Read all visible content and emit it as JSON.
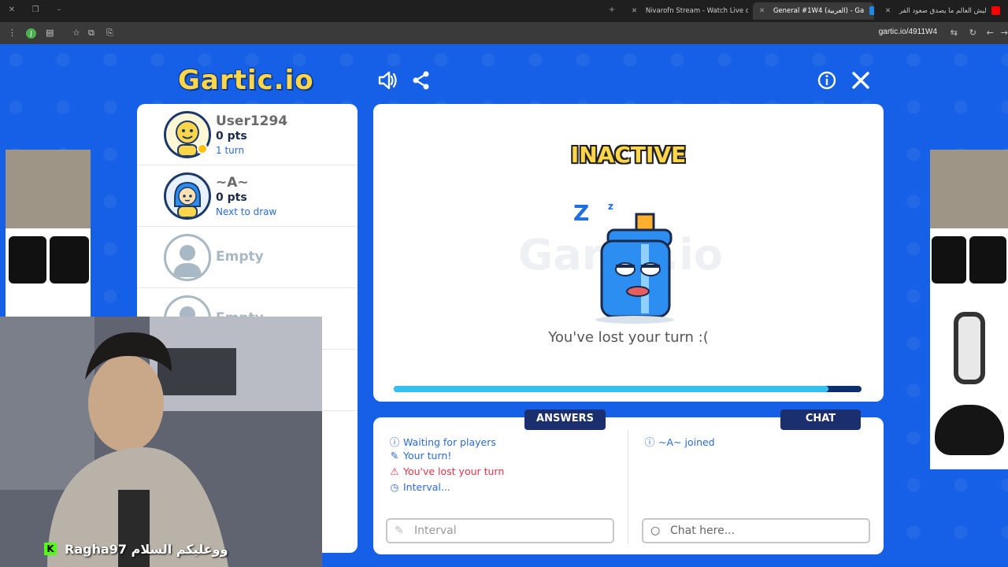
{
  "browser": {
    "tabs": [
      {
        "title": "ليش العالم ما يصدق صعود الفر",
        "active": false
      },
      {
        "title": "General #1W4 (العربية) - Ga",
        "active": true
      },
      {
        "title": "Nivarofn Stream - Watch Live o",
        "active": false
      }
    ],
    "url": "gartic.io/4911W4",
    "profile_initial": "J"
  },
  "game": {
    "logo": "Gartic.io",
    "players": [
      {
        "name": "User1294",
        "pts": "0 pts",
        "sub": "1 turn"
      },
      {
        "name": "~A~",
        "pts": "0 pts",
        "sub": "Next to draw"
      },
      {
        "name": "Empty"
      },
      {
        "name": "Empty"
      }
    ],
    "status_title": "INACTIVE",
    "watermark": "Gartic.io",
    "status_message": "You've lost your turn :(",
    "progress": 0.93,
    "answers_tab": "ANSWERS",
    "chat_tab": "CHAT",
    "answers_messages": [
      {
        "icon": "info-icon",
        "text": "Waiting for players",
        "color": "#2a6bd6"
      },
      {
        "icon": "pencil-icon",
        "text": "Your turn!",
        "color": "#2a6bd6"
      },
      {
        "icon": "warning-icon",
        "text": "You've lost your turn",
        "color": "#e0334b"
      },
      {
        "icon": "clock-icon",
        "text": "Interval...",
        "color": "#2a6bd6"
      }
    ],
    "chat_messages": [
      {
        "icon": "info-icon",
        "text": "~A~ joined",
        "color": "#2a6bd6"
      }
    ],
    "answer_placeholder": "Interval",
    "chat_placeholder": "Chat here..."
  },
  "webcam": {
    "caption": "Ragha97 ووعليكم السلام",
    "badge": "K"
  }
}
